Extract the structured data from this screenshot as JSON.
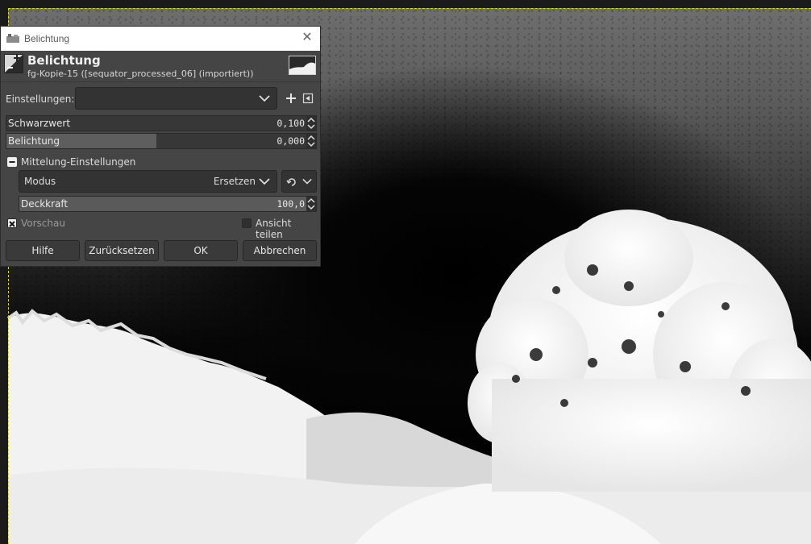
{
  "window": {
    "title": "Belichtung",
    "close_glyph": "✕"
  },
  "header": {
    "title": "Belichtung",
    "subtitle": "fg-Kopie-15 ([sequator_processed_06] (importiert))",
    "icon": "exposure-tool-icon"
  },
  "settings": {
    "label": "Einstellungen:",
    "preset_value": "",
    "add_icon": "plus-icon",
    "menu_icon": "preset-menu-icon"
  },
  "sliders": [
    {
      "name": "Schwarzwert",
      "value": "0,100",
      "fraction": 0.0
    },
    {
      "name": "Belichtung",
      "value": "0,000",
      "fraction": 0.5
    }
  ],
  "blend": {
    "section_label": "Mittelung-Einstellungen",
    "mode_label": "Modus",
    "mode_value": "Ersetzen",
    "opacity_label": "Deckkraft",
    "opacity_value": "100,0",
    "opacity_fraction": 1.0
  },
  "preview": {
    "label": "Vorschau",
    "checked": true
  },
  "split_view": {
    "label": "Ansicht teilen",
    "checked": false
  },
  "buttons": {
    "help": "Hilfe",
    "reset": "Zurücksetzen",
    "ok": "OK",
    "cancel": "Abbrechen"
  },
  "colors": {
    "dialog_bg": "#454545",
    "selection_outline": "#d8d820"
  }
}
